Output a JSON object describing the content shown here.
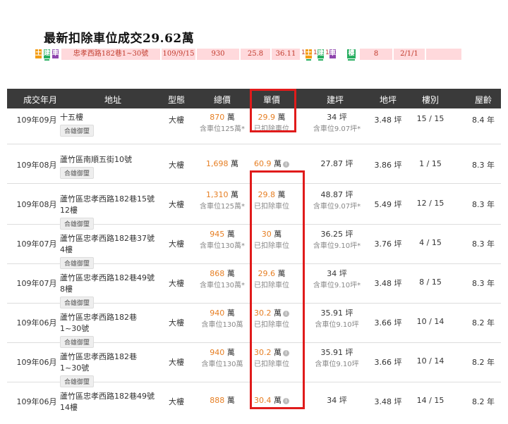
{
  "headline": "最新扣除車位成交29.62萬",
  "strip": {
    "tag_tu": "土",
    "tag_jian": "建",
    "tag_che": "車",
    "address": "忠孝西路182巷1~30號",
    "date": "109/9/15",
    "total": "930",
    "unit": "25.8",
    "area": "36.11",
    "tag_1": "1",
    "tag_tu2": "土",
    "tag_1b": "1",
    "tag_jian2": "建",
    "tag_1c": "1",
    "tag_che2": "車",
    "tag_lou": "樓",
    "floor": "8",
    "layout": "2/1/1"
  },
  "header": {
    "date": "成交年月",
    "address": "地址",
    "type": "型態",
    "total": "總價",
    "unit": "單價",
    "area": "建坪",
    "land": "地坪",
    "floor": "樓別",
    "age": "屋齡"
  },
  "rows": [
    {
      "date": "109年09月",
      "addr1": "十五樓",
      "addr2": "",
      "tag": "合雄御璽",
      "type": "大樓",
      "total": "870",
      "total_unit": "萬",
      "total_note": "含車位125萬*",
      "unit": "29.9",
      "unit_u": "萬",
      "unit_note": "已扣除車位",
      "area": "34",
      "area_u": "坪",
      "area_note": "含車位9.07坪*",
      "land": "3.48 坪",
      "floor": "15 / 15",
      "age": "8.4 年"
    },
    {
      "date": "109年08月",
      "addr1": "蘆竹區南順五街10號",
      "addr2": "",
      "tag": "合雄御璽",
      "type": "大樓",
      "total": "1,698",
      "total_unit": "萬",
      "total_note": "",
      "unit": "60.9",
      "unit_u": "萬",
      "unit_note": "",
      "area": "27.87 坪",
      "area_u": "",
      "area_note": "",
      "land": "3.86 坪",
      "floor": "1 / 15",
      "age": "8.3 年"
    },
    {
      "date": "109年08月",
      "addr1": "蘆竹區忠孝西路182巷15號",
      "addr2": "12樓",
      "tag": "合雄御璽",
      "type": "大樓",
      "total": "1,310",
      "total_unit": "萬",
      "total_note": "含車位125萬*",
      "unit": "29.8",
      "unit_u": "萬",
      "unit_note": "已扣除車位",
      "area": "48.87",
      "area_u": "坪",
      "area_note": "含車位9.07坪*",
      "land": "5.49 坪",
      "floor": "12 / 15",
      "age": "8.3 年"
    },
    {
      "date": "109年07月",
      "addr1": "蘆竹區忠孝西路182巷37號",
      "addr2": "4樓",
      "tag": "合雄御璽",
      "type": "大樓",
      "total": "945",
      "total_unit": "萬",
      "total_note": "含車位130萬*",
      "unit": "30",
      "unit_u": "萬",
      "unit_note": "已扣除車位",
      "area": "36.25",
      "area_u": "坪",
      "area_note": "含車位9.10坪*",
      "land": "3.76 坪",
      "floor": "4 / 15",
      "age": "8.3 年"
    },
    {
      "date": "109年07月",
      "addr1": "蘆竹區忠孝西路182巷49號",
      "addr2": "8樓",
      "tag": "合雄御璽",
      "type": "大樓",
      "total": "868",
      "total_unit": "萬",
      "total_note": "含車位130萬*",
      "unit": "29.6",
      "unit_u": "萬",
      "unit_note": "已扣除車位",
      "area": "34",
      "area_u": "坪",
      "area_note": "含車位9.10坪*",
      "land": "3.48 坪",
      "floor": "8 / 15",
      "age": "8.3 年"
    },
    {
      "date": "109年06月",
      "addr1": "蘆竹區忠孝西路182巷",
      "addr2": "1~30號",
      "tag": "合雄御璽",
      "type": "大樓",
      "total": "940",
      "total_unit": "萬",
      "total_note": "含車位130萬",
      "unit": "30.2",
      "unit_u": "萬",
      "unit_note": "已扣除車位",
      "area": "35.91",
      "area_u": "坪",
      "area_note": "含車位9.10坪",
      "land": "3.66 坪",
      "floor": "10 / 14",
      "age": "8.2 年"
    },
    {
      "date": "109年06月",
      "addr1": "蘆竹區忠孝西路182巷",
      "addr2": "1~30號",
      "tag": "合雄御璽",
      "type": "大樓",
      "total": "940",
      "total_unit": "萬",
      "total_note": "含車位130萬",
      "unit": "30.2",
      "unit_u": "萬",
      "unit_note": "已扣除車位",
      "area": "35.91",
      "area_u": "坪",
      "area_note": "含車位9.10坪",
      "land": "3.66 坪",
      "floor": "10 / 14",
      "age": "8.2 年"
    },
    {
      "date": "109年06月",
      "addr1": "蘆竹區忠孝西路182巷49號",
      "addr2": "14樓",
      "tag": "",
      "type": "大樓",
      "total": "888",
      "total_unit": "萬",
      "total_note": "",
      "unit": "30.4",
      "unit_u": "萬",
      "unit_note": "",
      "area": "34",
      "area_u": "坪",
      "area_note": "",
      "land": "3.48 坪",
      "floor": "14 / 15",
      "age": "8.2 年"
    }
  ]
}
